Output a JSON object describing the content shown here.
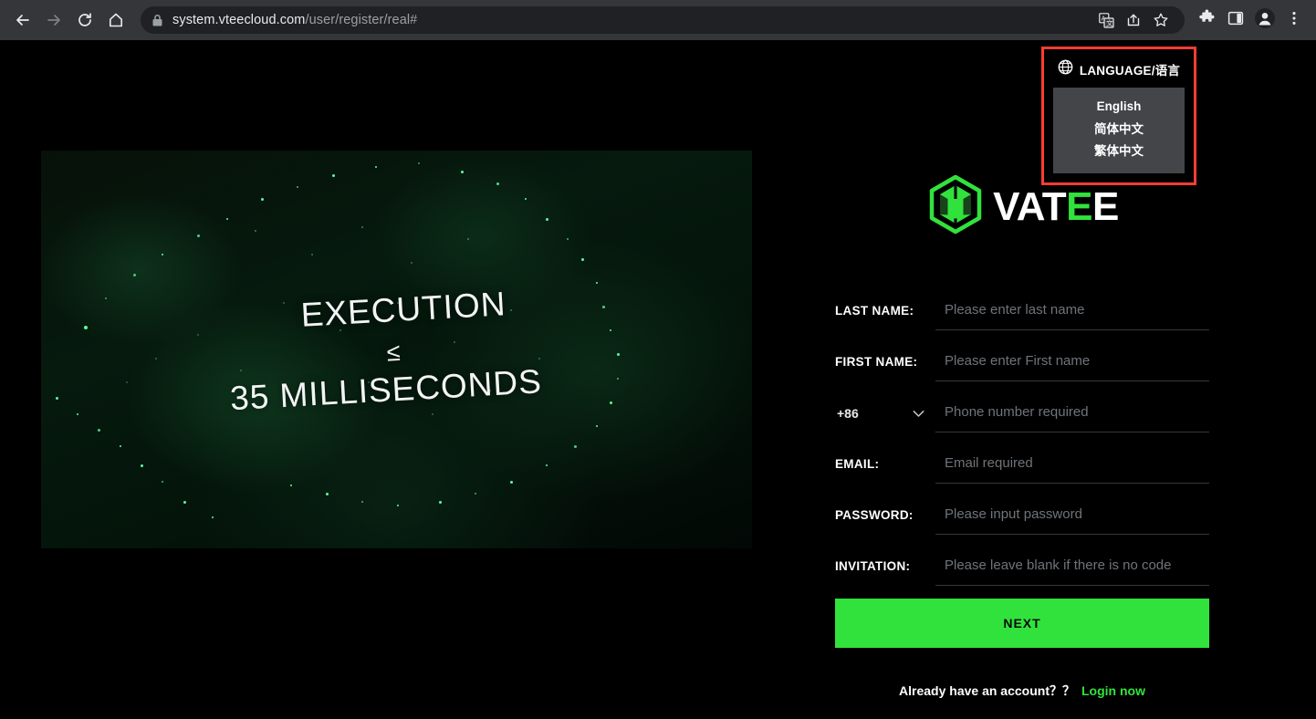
{
  "browser": {
    "back_icon": "back-arrow-icon",
    "forward_icon": "forward-arrow-icon",
    "reload_icon": "reload-icon",
    "home_icon": "home-icon",
    "lock_icon": "lock-icon",
    "url_domain": "system.vteecloud.com",
    "url_path": "/user/register/real#",
    "translate_icon": "translate-icon",
    "share_icon": "share-icon",
    "bookmark_icon": "star-icon",
    "extensions_icon": "puzzle-piece-icon",
    "sidepanel_icon": "side-panel-icon",
    "profile_icon": "profile-avatar-icon",
    "menu_icon": "three-dot-menu-icon"
  },
  "promo": {
    "line1": "EXECUTION",
    "line2": "≤",
    "line3": "35 MILLISECONDS"
  },
  "language": {
    "globe_icon": "globe-icon",
    "title": "LANGUAGE/语言",
    "highlight_color": "#fa3e32",
    "menu_bg": "#434549",
    "options": [
      {
        "label": "English"
      },
      {
        "label": "简体中文"
      },
      {
        "label": "繁体中文"
      }
    ]
  },
  "logo": {
    "mark": "vatee-hexagon-logo",
    "text_white_1": "VAT",
    "text_green": "E",
    "text_white_2": "E",
    "accent_color": "#31e23c"
  },
  "form": {
    "fields": [
      {
        "label": "LAST NAME:",
        "placeholder": "Please enter last name",
        "value": ""
      },
      {
        "label": "FIRST NAME:",
        "placeholder": "Please enter First name",
        "value": ""
      },
      {
        "label": "",
        "placeholder": "Phone number required",
        "value": ""
      },
      {
        "label": "EMAIL:",
        "placeholder": "Email required",
        "value": ""
      },
      {
        "label": "PASSWORD:",
        "placeholder": "Please input password",
        "value": ""
      },
      {
        "label": "INVITATION:",
        "placeholder": "Please leave blank if there is no code",
        "value": ""
      }
    ],
    "country_code": "+86",
    "chevron_icon": "chevron-down-icon",
    "next_label": "NEXT"
  },
  "footer": {
    "question": "Already have an account？？",
    "login_label": "Login now"
  }
}
